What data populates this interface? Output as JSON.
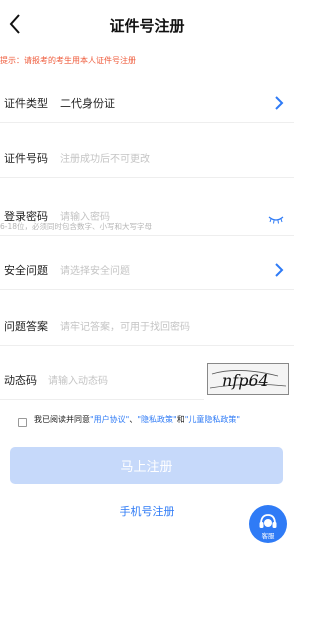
{
  "header": {
    "title": "证件号注册",
    "back_icon": "back-arrow-icon"
  },
  "tip": "提示：请报考的考生用本人证件号注册",
  "fields": {
    "id_type": {
      "label": "证件类型",
      "value": "二代身份证"
    },
    "id_number": {
      "label": "证件号码",
      "placeholder": "注册成功后不可更改"
    },
    "password": {
      "label": "登录密码",
      "placeholder": "请输入密码",
      "hint": "6-18位，必须同时包含数字、小写和大写字母"
    },
    "security_question": {
      "label": "安全问题",
      "placeholder": "请选择安全问题"
    },
    "answer": {
      "label": "问题答案",
      "placeholder": "请牢记答案，可用于找回密码"
    },
    "dynamic_code": {
      "label": "动态码",
      "placeholder": "请输入动态码",
      "captcha_text": "nfp64"
    }
  },
  "agreement": {
    "prefix": "我已阅读并同意",
    "user_protocol": "\"用户协议\"",
    "sep1": "、",
    "privacy": "\"隐私政策\"",
    "sep2": "和",
    "child_privacy": "\"儿童隐私政策\""
  },
  "submit_label": "马上注册",
  "phone_register_label": "手机号注册",
  "service_label": "客服",
  "colors": {
    "accent": "#2f7bf6",
    "tip": "#ef5a3a",
    "button_disabled": "#c6d9fa"
  }
}
